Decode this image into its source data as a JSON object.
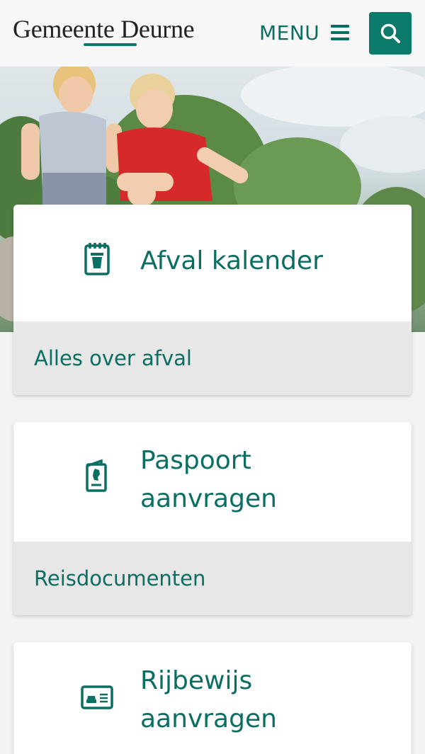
{
  "header": {
    "logo_text": "Gemeente Deurne",
    "menu_label": "MENU"
  },
  "cards": [
    {
      "title": "Afval kalender",
      "link": "Alles over afval",
      "icon": "calendar-bin-icon"
    },
    {
      "title": "Paspoort aanvragen",
      "link": "Reisdocumenten",
      "icon": "passport-icon"
    },
    {
      "title": "Rijbewijs aanvragen",
      "icon": "drivers-license-icon"
    }
  ],
  "colors": {
    "brand": "#0b7a6b",
    "text_accent": "#0b6e62",
    "card_footer": "#e7e7e7",
    "page_bg": "#f3f3f3"
  }
}
